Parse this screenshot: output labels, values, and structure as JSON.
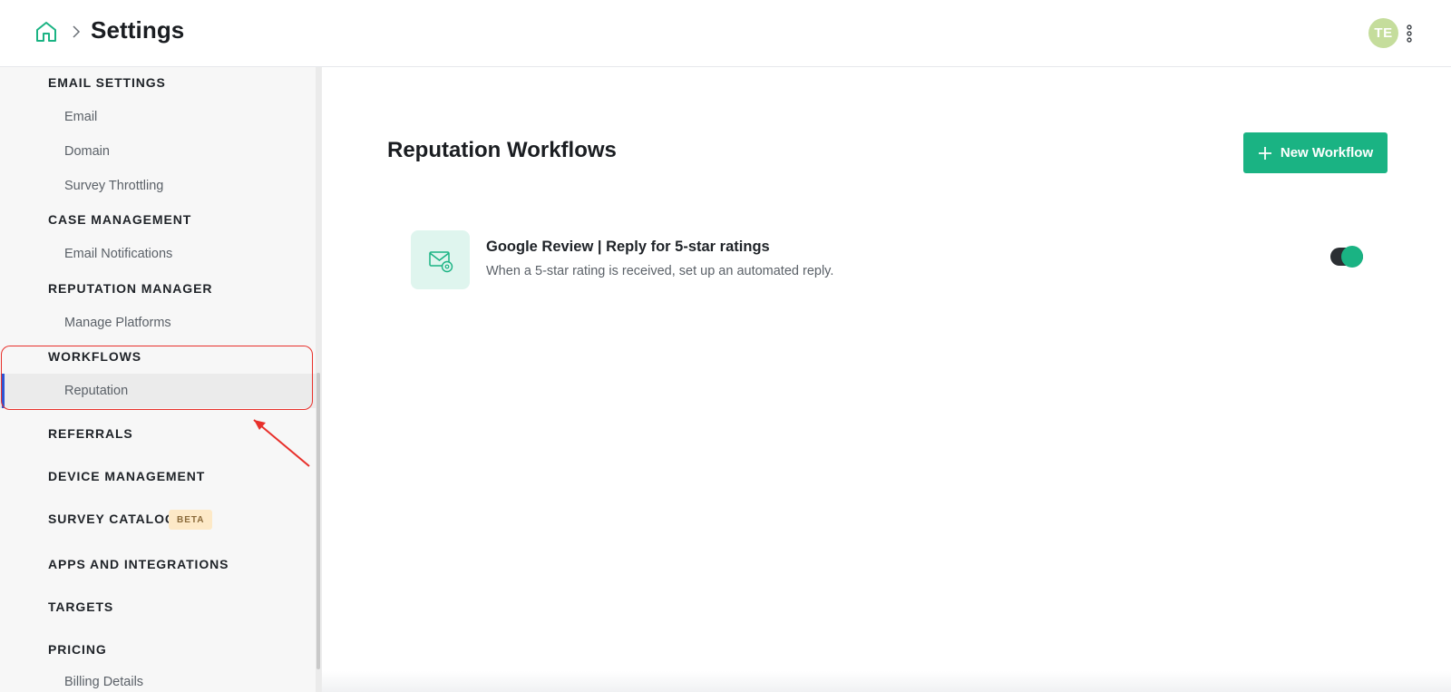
{
  "header": {
    "breadcrumb_title": "Settings",
    "avatar_initials": "TE",
    "accent_color": "#1ab383"
  },
  "sidebar": {
    "sections": [
      {
        "label": "EMAIL SETTINGS",
        "items": [
          "Email",
          "Domain",
          "Survey Throttling"
        ]
      },
      {
        "label": "CASE MANAGEMENT",
        "items": [
          "Email Notifications"
        ]
      },
      {
        "label": "REPUTATION MANAGER",
        "items": [
          "Manage Platforms"
        ]
      },
      {
        "label": "WORKFLOWS",
        "items": [
          "Reputation"
        ]
      },
      {
        "label": "REFERRALS",
        "items": []
      },
      {
        "label": "DEVICE MANAGEMENT",
        "items": []
      },
      {
        "label": "SURVEY CATALOG",
        "badge": "BETA",
        "items": []
      },
      {
        "label": "APPS AND INTEGRATIONS",
        "items": []
      },
      {
        "label": "TARGETS",
        "items": []
      },
      {
        "label": "PRICING",
        "items": [
          "Billing Details"
        ]
      }
    ],
    "active_item": "Reputation"
  },
  "main": {
    "title": "Reputation Workflows",
    "new_button_label": "New Workflow",
    "workflows": [
      {
        "title": "Google Review | Reply for 5-star ratings",
        "description": "When a 5-star rating is received, set up an automated reply.",
        "enabled": true
      }
    ]
  }
}
